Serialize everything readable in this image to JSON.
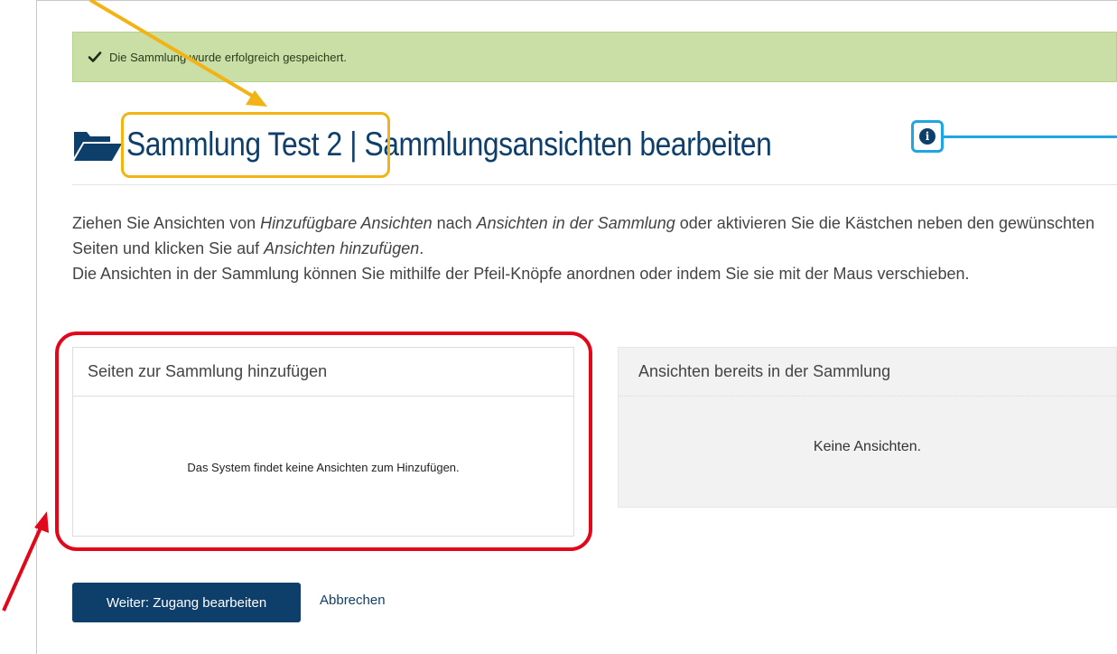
{
  "alert": {
    "icon": "check-icon",
    "message": "Die Sammlung wurde erfolgreich gespeichert."
  },
  "header": {
    "icon": "folder-open-icon",
    "collection_name": "Sammlung Test 2",
    "separator": " | ",
    "page_title": "Sammlungsansichten bearbeiten",
    "info_icon": "info-icon"
  },
  "description": {
    "line1_a": "Ziehen Sie Ansichten von ",
    "line1_b": "Hinzufügbare Ansichten",
    "line1_c": " nach ",
    "line1_d": "Ansichten in der Sammlung",
    "line1_e": " oder aktivieren Sie die Kästchen neben den gewünschten Seiten und klicken Sie auf ",
    "line1_f": "Ansichten hinzufügen",
    "line1_g": ".",
    "line2": "Die Ansichten in der Sammlung können Sie mithilfe der Pfeil-Knöpfe anordnen oder indem Sie sie mit der Maus verschieben."
  },
  "panel_add": {
    "heading": "Seiten zur Sammlung hinzufügen",
    "empty_text": "Das System findet keine Ansichten zum Hinzufügen."
  },
  "panel_existing": {
    "heading": "Ansichten bereits in der Sammlung",
    "empty_text": "Keine Ansichten."
  },
  "actions": {
    "next_label": "Weiter: Zugang bearbeiten",
    "cancel_label": "Abbrechen"
  },
  "colors": {
    "brand_blue": "#0e3f6b",
    "success_bg": "#c9dfa6",
    "annotation_yellow": "#f2b314",
    "annotation_blue": "#1ea5e3",
    "annotation_red": "#e2081b"
  }
}
